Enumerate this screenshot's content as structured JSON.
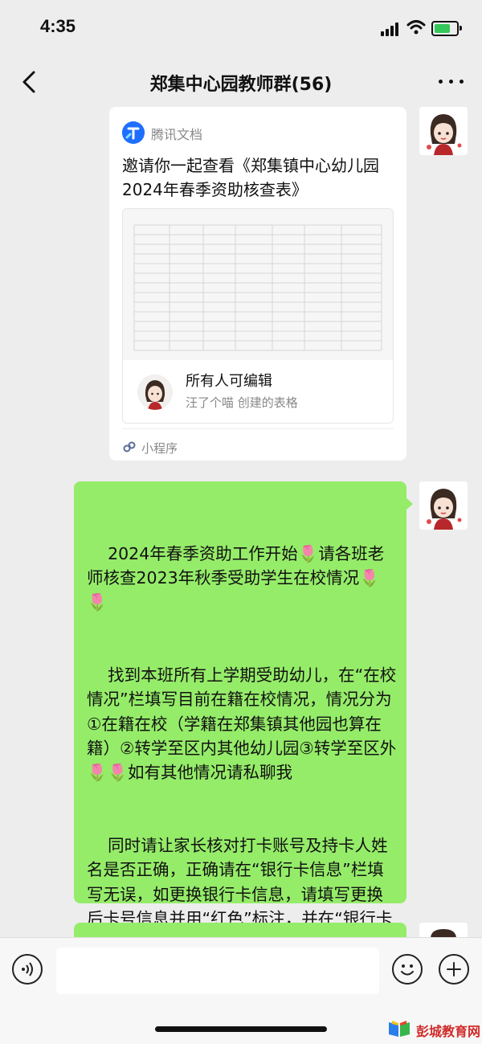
{
  "status_bar": {
    "time": "4:35"
  },
  "nav": {
    "title": "郑集中心园教师群(56)"
  },
  "doc_card": {
    "brand": "腾讯文档",
    "title": "邀请你一起查看《郑集镇中心幼儿园2024年春季资助核查表》",
    "permission": "所有人可编辑",
    "creator": "汪了个喵 创建的表格",
    "footer_label": "小程序"
  },
  "message": {
    "paragraphs": [
      "    2024年春季资助工作开始🌷请各班老师核查2023年秋季受助学生在校情况🌷🌷",
      "    找到本班所有上学期受助幼儿，在“在校情况”栏填写目前在籍在校情况，情况分为①在籍在校（学籍在郑集镇其他园也算在籍）②转学至区内其他幼儿园③转学至区外🌷🌷如有其他情况请私聊我",
      "    同时请让家长核对打卡账号及持卡人姓名是否正确，正确请在“银行卡信息”栏填写无误，如更换银行卡信息，请填写更换后卡号信息并用“红色”标注，并在“银行卡信息”栏填写更新🌷🌷"
    ]
  },
  "watermark": "彭城教育网",
  "colors": {
    "chat_bg": "#ededed",
    "bubble_green": "#95ec69",
    "tencent_blue": "#1e6fff",
    "watermark_red": "#d12b2b"
  }
}
